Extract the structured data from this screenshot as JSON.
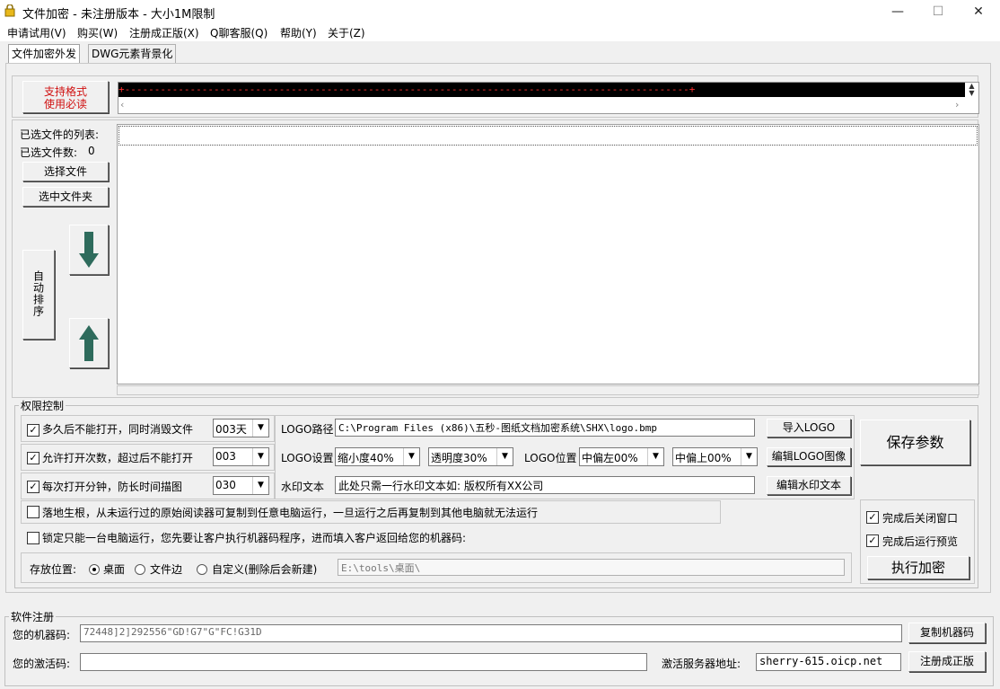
{
  "window": {
    "title": "文件加密 - 未注册版本 - 大小1M限制",
    "minimize": "—",
    "maximize": "☐",
    "close": "✕"
  },
  "menu": [
    "申请试用(V)",
    "购买(W)",
    "注册成正版(X)",
    "Q聊客服(Q)",
    "帮助(Y)",
    "关于(Z)"
  ],
  "tabs": [
    "文件加密外发",
    "DWG元素背景化"
  ],
  "format_button": {
    "line1": "支持格式",
    "line2": "使用必读"
  },
  "format_text": "+-----------------------------------------------------------------------------------------------+",
  "file_list": {
    "label": "已选文件的列表:",
    "count_label": "已选文件数:",
    "count": "0",
    "select_file": "选择文件",
    "select_folder": "选中文件夹",
    "auto_sort": "自动排序"
  },
  "permissions": {
    "title": "权限控制",
    "opt1": {
      "label": "多久后不能打开，同时消毁文件",
      "value": "003天",
      "checked": true
    },
    "opt2": {
      "label": "允许打开次数，超过后不能打开",
      "value": "003",
      "checked": true
    },
    "opt3": {
      "label": "每次打开分钟，防长时间描图",
      "value": "030",
      "checked": true
    },
    "logo_path_label": "LOGO路径",
    "logo_path": "C:\\Program Files (x86)\\五秒-图纸文档加密系统\\SHX\\logo.bmp",
    "import_logo": "导入LOGO",
    "logo_settings_label": "LOGO设置",
    "scale": "缩小度40%",
    "opacity": "透明度30%",
    "logo_position_label": "LOGO位置",
    "pos_h": "中偏左00%",
    "pos_v": "中偏上00%",
    "edit_logo": "编辑LOGO图像",
    "watermark_label": "水印文本",
    "watermark_text": "此处只需一行水印文本如: 版权所有XX公司",
    "edit_watermark": "编辑水印文本",
    "save_params": "保存参数",
    "root_option": "落地生根，从未运行过的原始阅读器可复制到任意电脑运行，一旦运行之后再复制到其他电脑就无法运行",
    "lock_option": "锁定只能一台电脑运行，您先要让客户执行机器码程序，进而填入客户返回给您的机器码:",
    "save_location_label": "存放位置:",
    "loc_desktop": "桌面",
    "loc_file_side": "文件边",
    "loc_custom": "自定义(删除后会新建)",
    "custom_path": "E:\\tools\\桌面\\",
    "close_after": "完成后关闭窗口",
    "preview_after": "完成后运行预览",
    "run_encrypt": "执行加密"
  },
  "registration": {
    "title": "软件注册",
    "machine_code_label": "您的机器码:",
    "machine_code": "72448]2]292556\"GD!G7\"G\"FC!G31D",
    "copy_code": "复制机器码",
    "activation_label": "您的激活码:",
    "activation_code": "",
    "server_label": "激活服务器地址:",
    "server": "sherry-615.oicp.net",
    "register": "注册成正版"
  }
}
